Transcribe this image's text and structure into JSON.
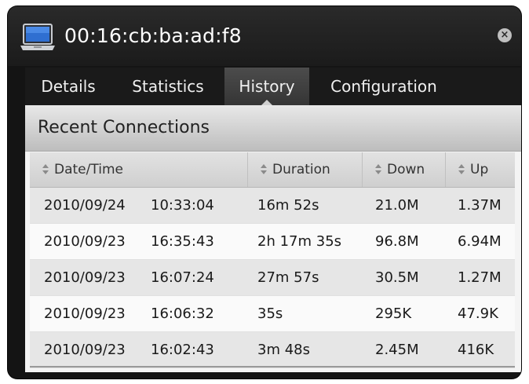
{
  "window": {
    "title": "00:16:cb:ba:ad:f8",
    "device_icon": "laptop-icon",
    "close_icon": "close-icon",
    "close_glyph": "×"
  },
  "tabs": [
    {
      "label": "Details",
      "active": false
    },
    {
      "label": "Statistics",
      "active": false
    },
    {
      "label": "History",
      "active": true
    },
    {
      "label": "Configuration",
      "active": false
    }
  ],
  "section": {
    "title": "Recent Connections"
  },
  "table": {
    "columns": [
      "Date/Time",
      "Duration",
      "Down",
      "Up"
    ],
    "rows": [
      {
        "date": "2010/09/24",
        "time": "10:33:04",
        "duration": "16m 52s",
        "down": "21.0M",
        "up": "1.37M"
      },
      {
        "date": "2010/09/23",
        "time": "16:35:43",
        "duration": "2h 17m 35s",
        "down": "96.8M",
        "up": "6.94M"
      },
      {
        "date": "2010/09/23",
        "time": "16:07:24",
        "duration": "27m 57s",
        "down": "30.5M",
        "up": "1.27M"
      },
      {
        "date": "2010/09/23",
        "time": "16:06:32",
        "duration": "35s",
        "down": "295K",
        "up": "47.9K"
      },
      {
        "date": "2010/09/23",
        "time": "16:02:43",
        "duration": "3m 48s",
        "down": "2.45M",
        "up": "416K"
      }
    ]
  },
  "colors": {
    "window_bg": "#141414",
    "active_tab": "#404040",
    "row_even": "#e6e6e6",
    "row_odd": "#fafafa"
  }
}
